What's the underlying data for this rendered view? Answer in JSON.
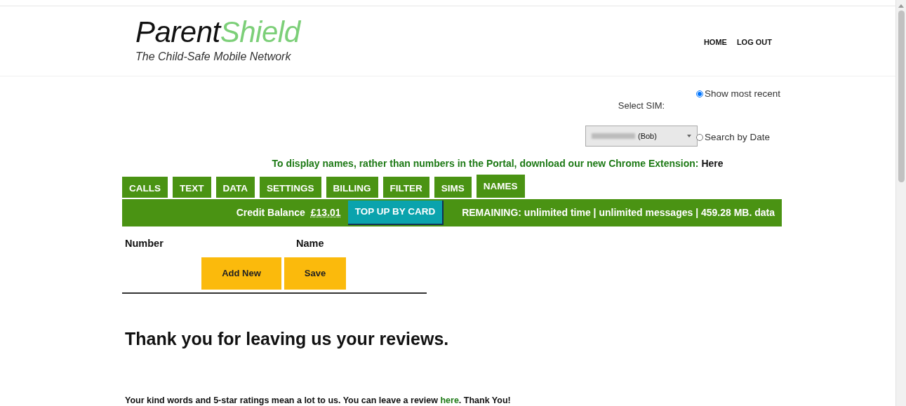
{
  "logo": {
    "name_first": "Parent",
    "name_second": "Shield",
    "tagline": "The Child-Safe Mobile Network"
  },
  "nav": [
    {
      "label": "HOME"
    },
    {
      "label": "LOG OUT"
    }
  ],
  "sim_selector": {
    "label": "Select SIM:",
    "value": "(Bob)"
  },
  "view_options": [
    {
      "label": "Show most recent",
      "selected": true
    },
    {
      "label": "Search by Date",
      "selected": false
    }
  ],
  "extension_notice": {
    "text": "To display names, rather than numbers in the Portal, download our new Chrome Extension:",
    "link": "Here"
  },
  "tabs": [
    {
      "label": "CALLS",
      "selected": false
    },
    {
      "label": "TEXT",
      "selected": false
    },
    {
      "label": "DATA",
      "selected": false
    },
    {
      "label": "SETTINGS",
      "selected": false
    },
    {
      "label": "BILLING",
      "selected": false
    },
    {
      "label": "FILTER",
      "selected": false
    },
    {
      "label": "SIMS",
      "selected": false
    },
    {
      "label": "NAMES",
      "selected": true
    }
  ],
  "credit": {
    "label": "Credit Balance",
    "amount": "£13.01",
    "button": "TOP UP BY CARD",
    "remaining": "REMAINING: unlimited time | unlimited messages | 459.28 MB. data"
  },
  "names_table": {
    "columns": [
      "Number",
      "Name"
    ],
    "buttons": [
      "Add New",
      "Save"
    ]
  },
  "reviews": {
    "heading": "Thank you for leaving us your reviews.",
    "text": "Your kind words and 5-star ratings mean a lot to us. You can leave a review",
    "link": "here",
    "text_after": ". Thank You!"
  }
}
